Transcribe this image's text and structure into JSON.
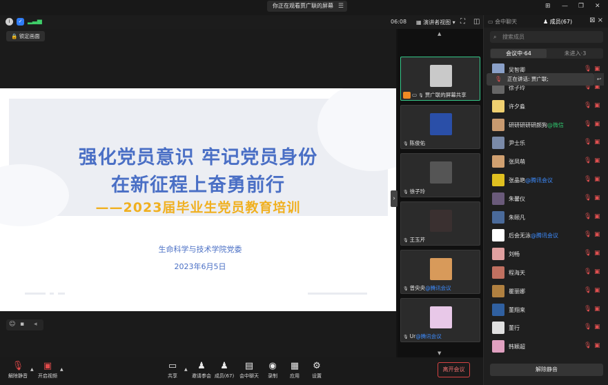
{
  "banner": {
    "text": "你正在观看贾广联的屏幕",
    "icon": "collapse-icon"
  },
  "infobar": {
    "timer": "06:08",
    "view_mode": "演讲者视图"
  },
  "stage": {
    "lock_label": "锁定画面",
    "slide": {
      "title_line1": "强化党员意识 牢记党员身份",
      "title_line2": "在新征程上奋勇前行",
      "subtitle": "——2023届毕业生党员教育培训",
      "org": "生命科学与技术学院党委",
      "date": "2023年6月5日"
    }
  },
  "videos": [
    {
      "name": "贾广联的屏幕共享",
      "tag": "",
      "color": "#c9c9c9"
    },
    {
      "name": "陈俊佑",
      "tag": "",
      "color": "#2a4fa8"
    },
    {
      "name": "徐子玲",
      "tag": "",
      "color": "#555555"
    },
    {
      "name": "王玉芹",
      "tag": "",
      "color": "#3a3030"
    },
    {
      "name": "曾央央",
      "tag": "@腾讯会议",
      "color": "#d89a5a"
    },
    {
      "name": "Ur",
      "tag": "@腾讯会议",
      "color": "#e8c8e8"
    }
  ],
  "panel": {
    "tab_chat": "会中聊天",
    "tab_members": "成员(67)",
    "search_placeholder": "搜索成员",
    "seg_in": "会议中·64",
    "seg_out": "未进入·3",
    "speaking": "正在讲话: 贾广联;",
    "unmute_all": "解除静音",
    "members": [
      {
        "name": "吴智卿",
        "tag": "",
        "color": "#8aa0c8"
      },
      {
        "name": "徐子玲",
        "tag": "",
        "color": "#666"
      },
      {
        "name": "许夕淼",
        "tag": "",
        "color": "#f0d070"
      },
      {
        "name": "研研研研研颜狗",
        "tag": "@微信",
        "tagcolor": "green",
        "color": "#c89a70"
      },
      {
        "name": "尹士乐",
        "tag": "",
        "color": "#7a8aa8"
      },
      {
        "name": "张凤萌",
        "tag": "",
        "color": "#d0a070"
      },
      {
        "name": "张晶艳",
        "tag": "@腾讯会议",
        "tagcolor": "blue",
        "color": "#e0c020"
      },
      {
        "name": "朱馨仪",
        "tag": "",
        "color": "#6a5a7a"
      },
      {
        "name": "朱颐凡",
        "tag": "",
        "color": "#4a6a9a"
      },
      {
        "name": "后会无泳",
        "tag": "@腾讯会议",
        "tagcolor": "blue",
        "color": "#ffffff"
      },
      {
        "name": "刘畅",
        "tag": "",
        "color": "#e0a0a0"
      },
      {
        "name": "程海天",
        "tag": "",
        "color": "#c07060"
      },
      {
        "name": "瞿丽娜",
        "tag": "",
        "color": "#b08040"
      },
      {
        "name": "董翔来",
        "tag": "",
        "color": "#3060a0"
      },
      {
        "name": "董行",
        "tag": "",
        "color": "#e0e0e0"
      },
      {
        "name": "韩颖超",
        "tag": "",
        "color": "#e0a0c0"
      }
    ]
  },
  "toolbar": {
    "unmute": "解除静音",
    "video": "开启视频",
    "share": "共享",
    "invite": "邀请参会",
    "members": "成员(67)",
    "chat": "会中聊天",
    "record": "录制",
    "apps": "应用",
    "settings": "设置",
    "leave": "离开会议"
  },
  "colors": {
    "accent_green": "#35c98a",
    "danger": "#e04a4a",
    "slide_blue": "#4a6fc5",
    "slide_gold": "#f0b020"
  }
}
